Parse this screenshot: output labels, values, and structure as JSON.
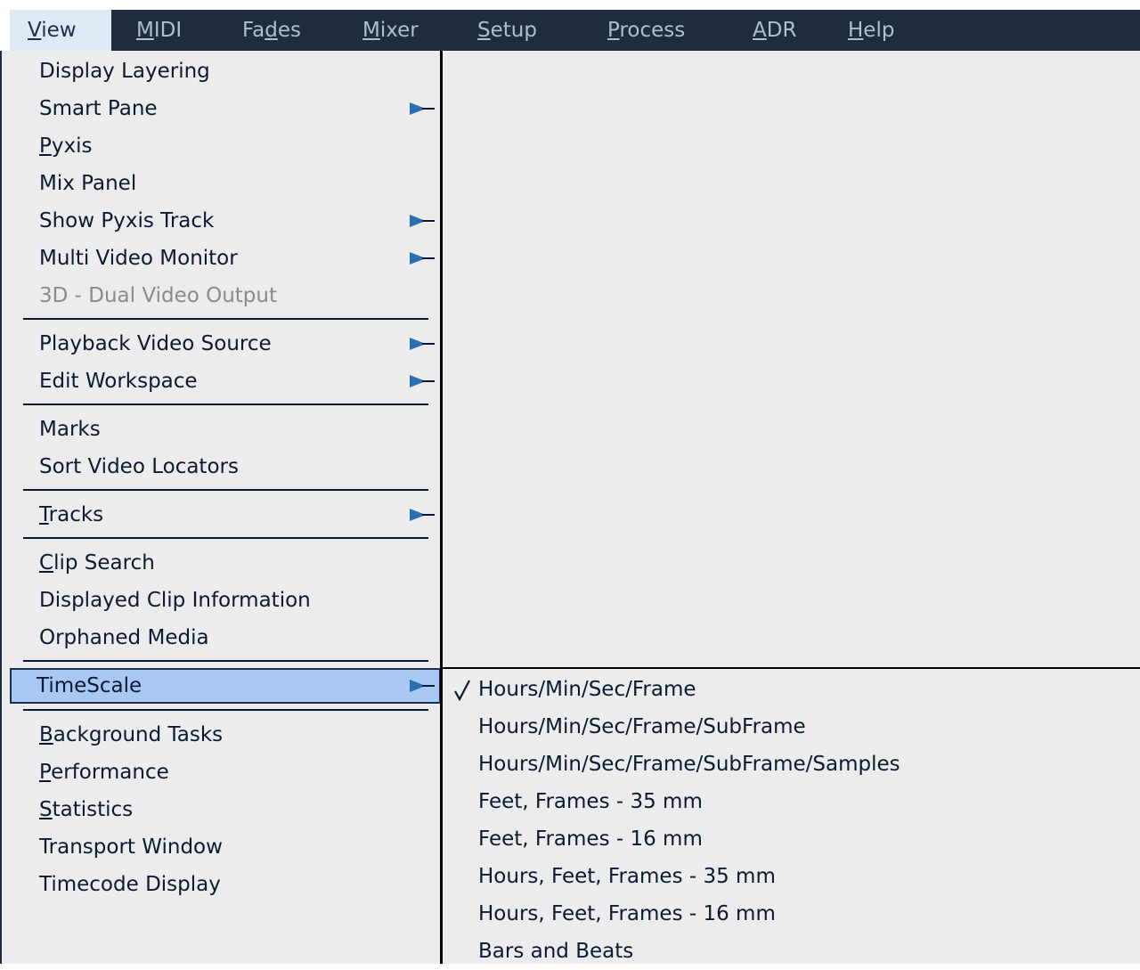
{
  "menubar": {
    "items": [
      {
        "label": "View",
        "accel": "V",
        "rest": "iew",
        "active": true
      },
      {
        "label": "MIDI",
        "accel": "M",
        "rest": "IDI"
      },
      {
        "label": "Fades",
        "pre": "Fa",
        "accel": "d",
        "rest": "es"
      },
      {
        "label": "Mixer",
        "accel": "M",
        "rest": "ixer"
      },
      {
        "label": "Setup",
        "accel": "S",
        "rest": "etup"
      },
      {
        "label": "Process",
        "accel": "P",
        "rest": "rocess"
      },
      {
        "label": "ADR",
        "accel": "A",
        "rest": "DR"
      },
      {
        "label": "Help",
        "accel": "H",
        "rest": "elp"
      }
    ]
  },
  "view_menu": {
    "items": [
      {
        "label": "Display Layering"
      },
      {
        "label": "Smart Pane",
        "submenu": true
      },
      {
        "label": "Pyxis",
        "accel": "P",
        "rest": "yxis"
      },
      {
        "label": "Mix Panel"
      },
      {
        "label": "Show Pyxis Track",
        "submenu": true
      },
      {
        "label": "Multi Video Monitor",
        "submenu": true
      },
      {
        "label": "3D - Dual Video Output",
        "disabled": true
      },
      {
        "label": "Playback Video Source",
        "submenu": true
      },
      {
        "label": "Edit Workspace",
        "submenu": true
      },
      {
        "label": "Marks"
      },
      {
        "label": "Sort Video Locators"
      },
      {
        "label": "Tracks",
        "accel": "T",
        "rest": "racks",
        "submenu": true
      },
      {
        "label": "Clip Search",
        "accel": "C",
        "rest": "lip Search"
      },
      {
        "label": "Displayed Clip Information"
      },
      {
        "label": "Orphaned Media"
      },
      {
        "label": "TimeScale",
        "submenu": true,
        "highlighted": true
      },
      {
        "label": "Background Tasks",
        "accel": "B",
        "rest": "ackground Tasks"
      },
      {
        "label": "Performance",
        "accel": "P",
        "rest": "erformance"
      },
      {
        "label": "Statistics",
        "accel": "S",
        "rest": "tatistics"
      },
      {
        "label": "Transport Window"
      },
      {
        "label": "Timecode Display"
      }
    ]
  },
  "timescale_submenu": {
    "items": [
      {
        "label": "Hours/Min/Sec/Frame",
        "checked": true
      },
      {
        "label": "Hours/Min/Sec/Frame/SubFrame"
      },
      {
        "label": "Hours/Min/Sec/Frame/SubFrame/Samples"
      },
      {
        "label": "Feet, Frames - 35 mm"
      },
      {
        "label": "Feet, Frames - 16 mm"
      },
      {
        "label": "Hours, Feet, Frames - 35 mm"
      },
      {
        "label": "Hours, Feet, Frames - 16 mm"
      },
      {
        "label": "Bars and Beats"
      }
    ]
  },
  "icons": {
    "submenu_arrow": "submenu-arrow-icon",
    "check": "check-icon"
  },
  "colors": {
    "menubar_bg": "#1f2c3d",
    "menubar_text": "#aebfd3",
    "menu_bg": "#ececec",
    "menu_text": "#0a1a33",
    "highlight_bg": "#a9c7f3",
    "disabled_text": "#8a8a8a",
    "arrow": "#2a6fb0"
  }
}
